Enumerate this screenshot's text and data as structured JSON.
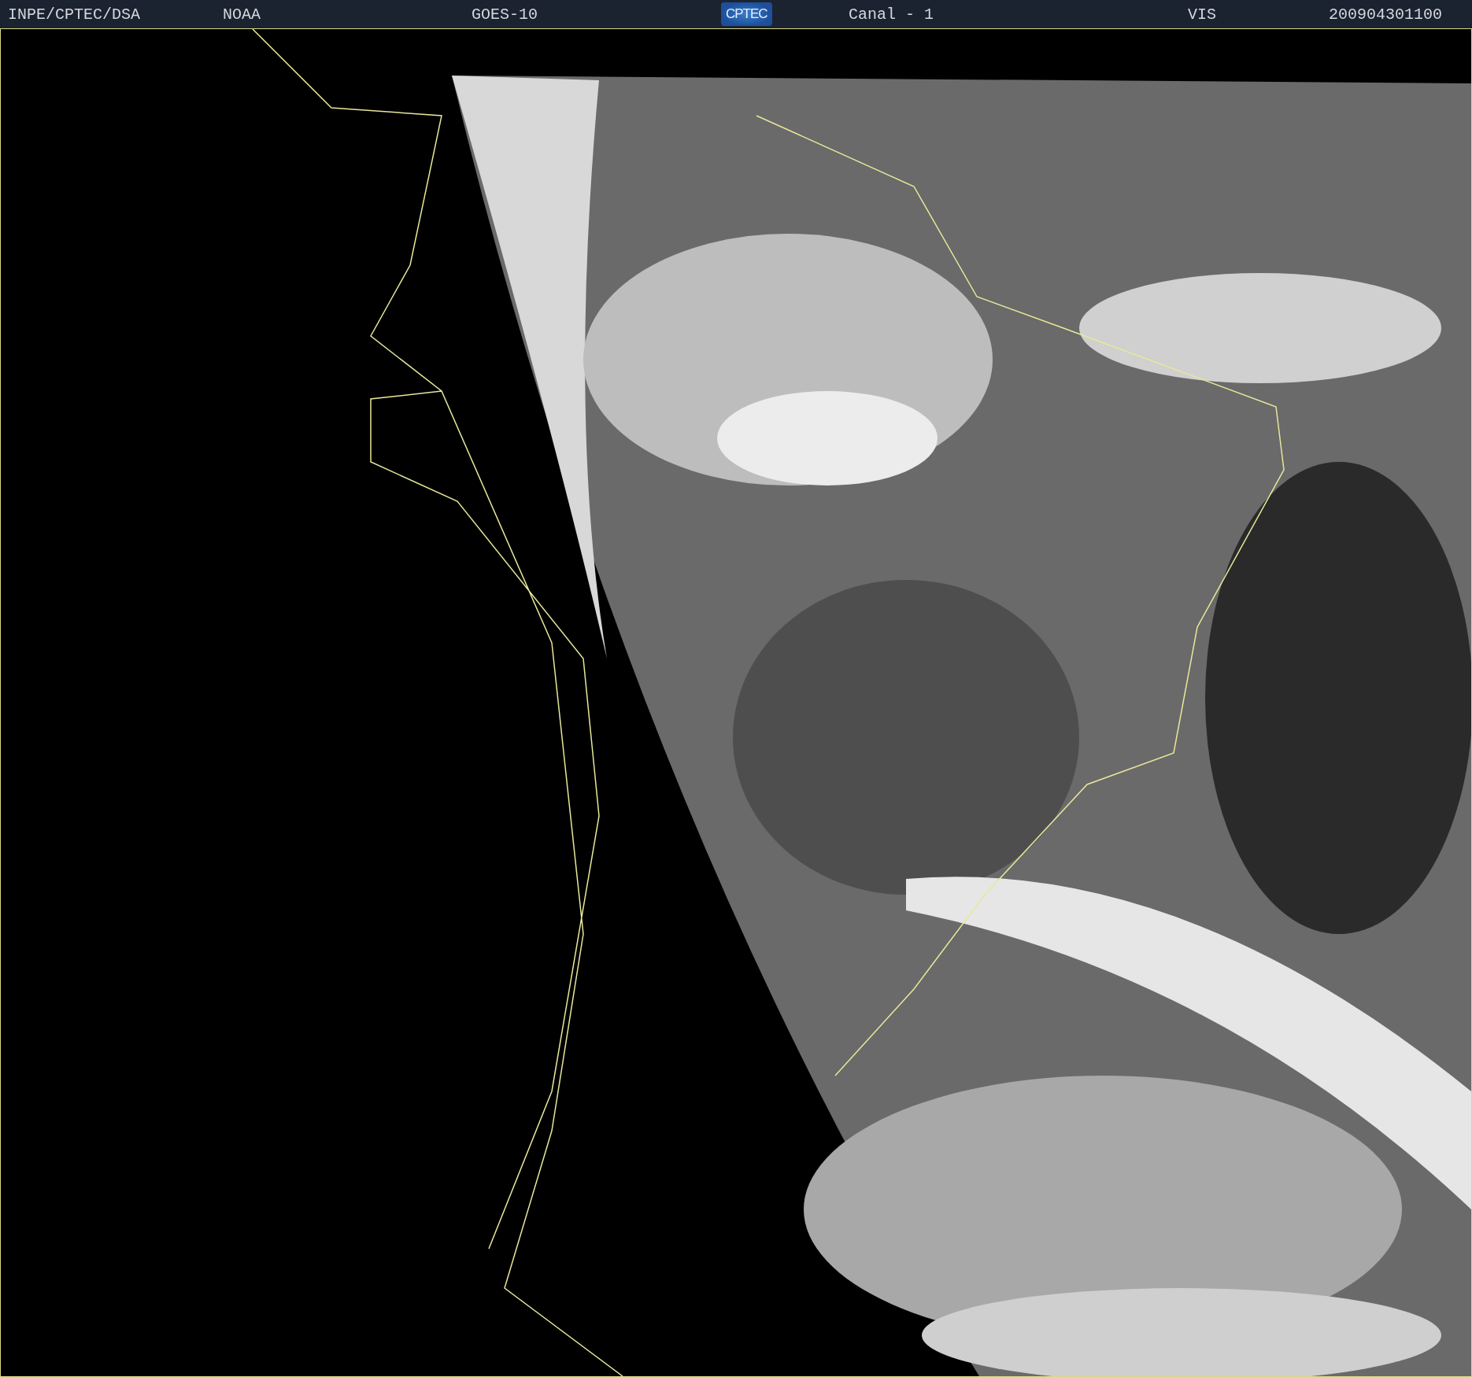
{
  "header": {
    "items": [
      {
        "kind": "text",
        "text": "INPE/CPTEC/DSA"
      },
      {
        "kind": "text",
        "text": "NOAA"
      },
      {
        "kind": "text",
        "text": "GOES-10"
      },
      {
        "kind": "logo",
        "text": "CPTEC"
      },
      {
        "kind": "text",
        "text": "Canal - 1"
      },
      {
        "kind": "text",
        "text": "VIS"
      },
      {
        "kind": "text",
        "text": "200904301100"
      }
    ]
  }
}
